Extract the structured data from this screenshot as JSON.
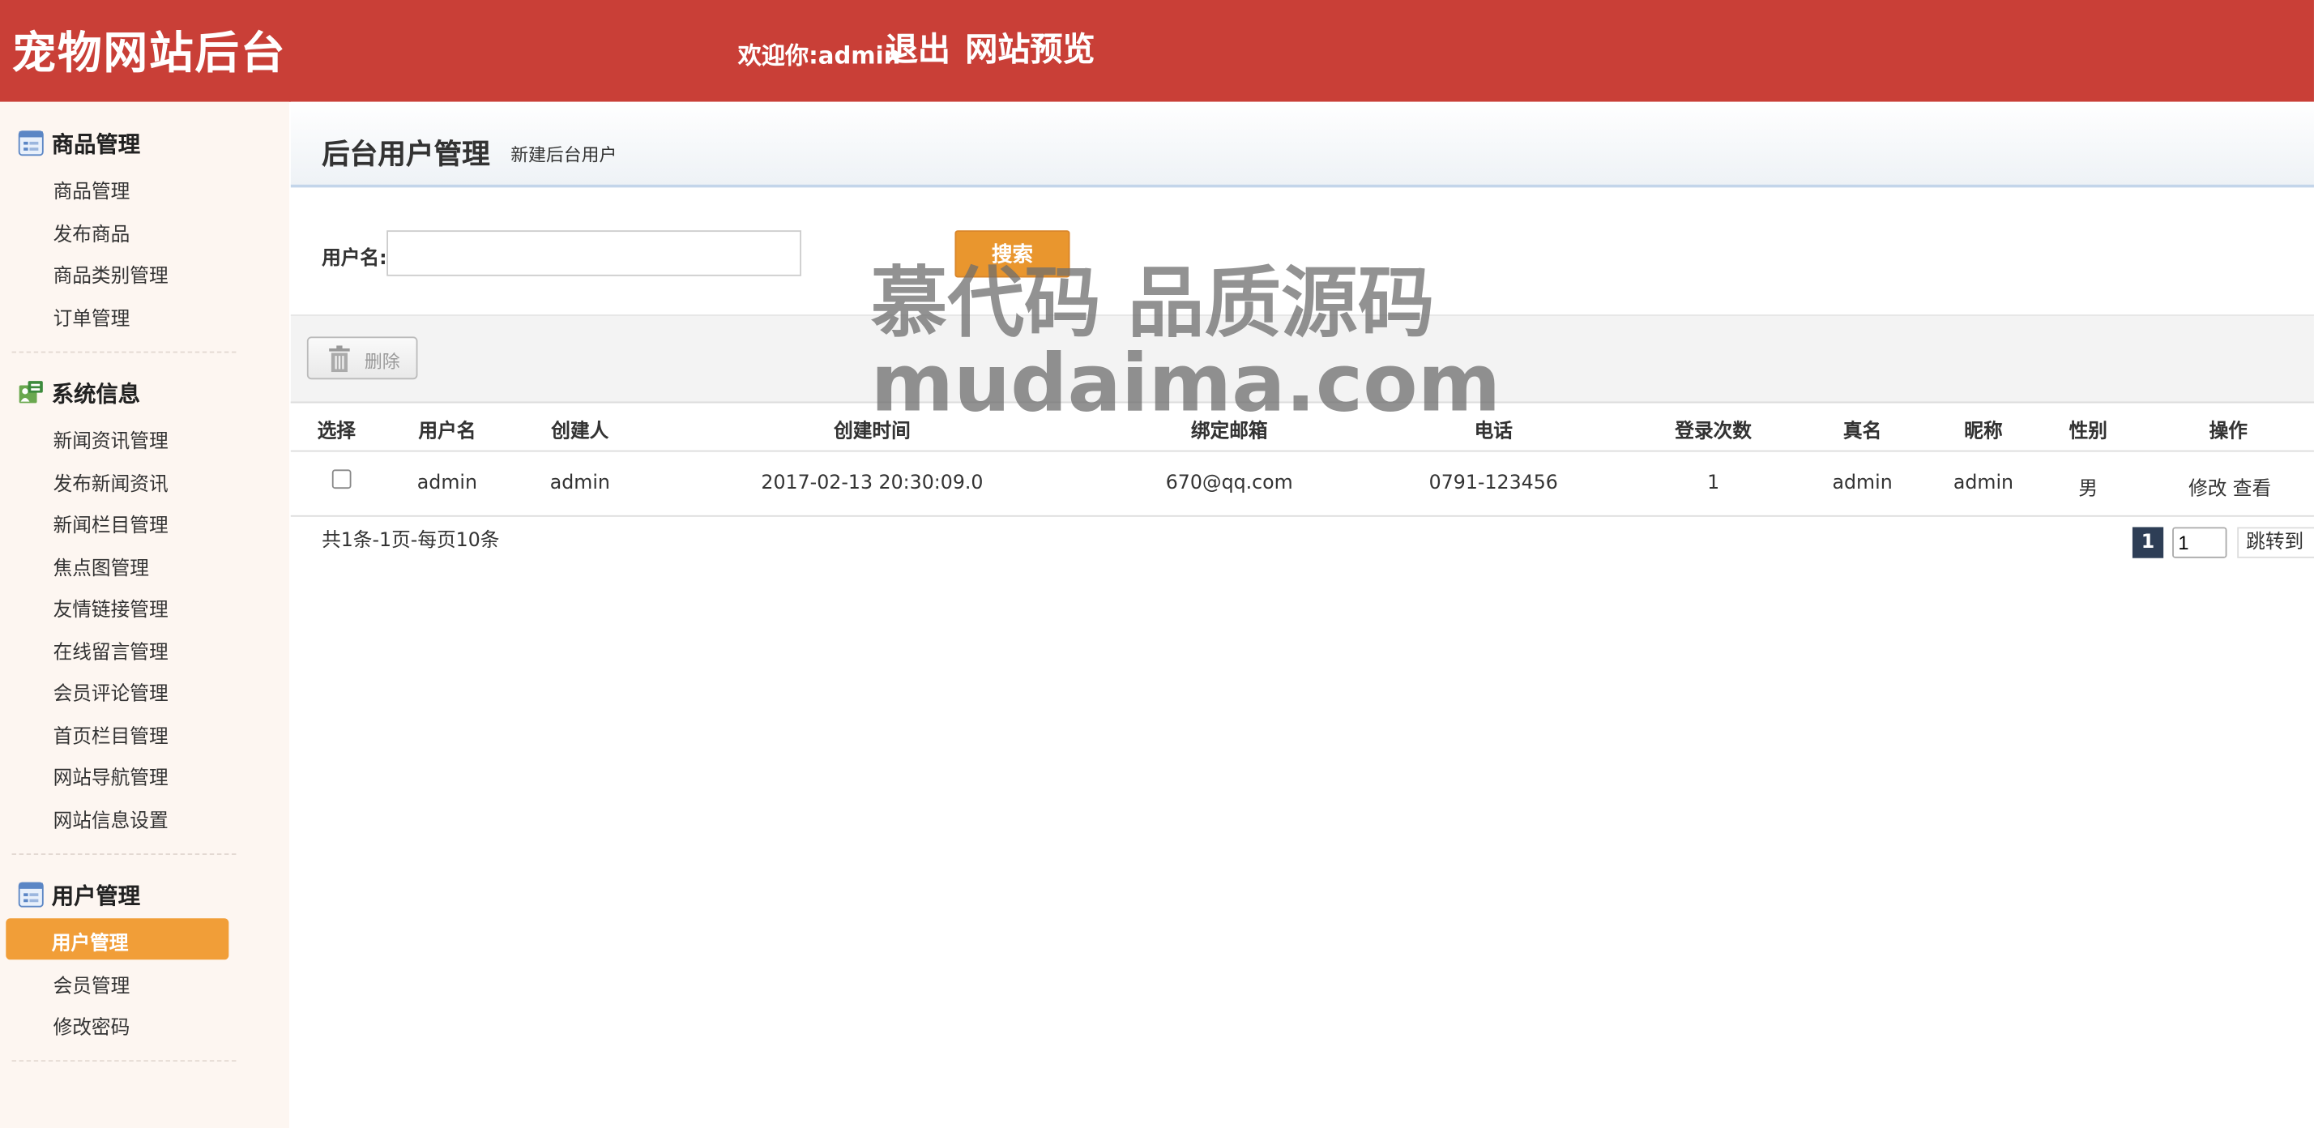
{
  "header": {
    "brand": "宠物网站后台",
    "welcome": "欢迎你:admin",
    "logout": "退出",
    "preview": "网站预览"
  },
  "sidebar": {
    "groups": [
      {
        "title": "商品管理",
        "icon": "product-list-icon",
        "items": [
          "商品管理",
          "发布商品",
          "商品类别管理",
          "订单管理"
        ]
      },
      {
        "title": "系统信息",
        "icon": "system-info-icon",
        "items": [
          "新闻资讯管理",
          "发布新闻资讯",
          "新闻栏目管理",
          "焦点图管理",
          "友情链接管理",
          "在线留言管理",
          "会员评论管理",
          "首页栏目管理",
          "网站导航管理",
          "网站信息设置"
        ]
      },
      {
        "title": "用户管理",
        "icon": "user-list-icon",
        "items": [
          "用户管理",
          "会员管理",
          "修改密码"
        ],
        "active": "用户管理"
      }
    ]
  },
  "main": {
    "title": "后台用户管理",
    "new_link": "新建后台用户",
    "search": {
      "label": "用户名:",
      "value": "",
      "button": "搜索"
    },
    "toolbar": {
      "delete": "删除"
    },
    "table": {
      "headers": [
        "选择",
        "用户名",
        "创建人",
        "创建时间",
        "绑定邮箱",
        "电话",
        "登录次数",
        "真名",
        "昵称",
        "性别",
        "操作"
      ],
      "rows": [
        {
          "username": "admin",
          "creator": "admin",
          "created": "2017-02-13 20:30:09.0",
          "email": "670@qq.com",
          "phone": "0791-123456",
          "logins": "1",
          "realname": "admin",
          "nickname": "admin",
          "gender": "男",
          "edit": "修改",
          "view": "查看"
        }
      ]
    },
    "pagination": {
      "info": "共1条-1页-每页10条",
      "current": "1",
      "input_value": "1",
      "jump": "跳转到"
    }
  },
  "watermark": {
    "line1": "慕代码 品质源码",
    "line2": "mudaima.com"
  },
  "colors": {
    "header": "#c93f37",
    "active": "#f19e38",
    "search_button": "#e9962e",
    "page_current": "#2e3e56",
    "sidebar_bg": "#fdf6f1"
  }
}
